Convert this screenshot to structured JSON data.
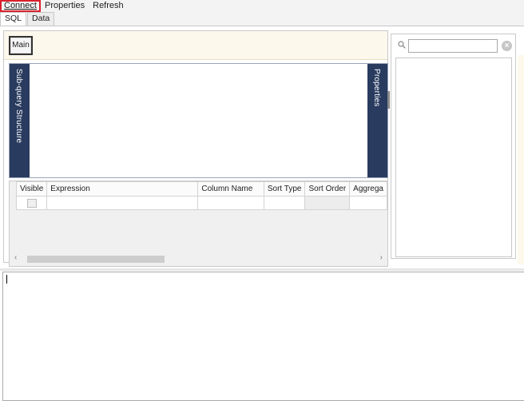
{
  "menu": {
    "items": [
      {
        "label": "Connect"
      },
      {
        "label": "Properties"
      },
      {
        "label": "Refresh"
      }
    ]
  },
  "tabs": [
    {
      "label": "SQL",
      "selected": true
    },
    {
      "label": "Data",
      "selected": false
    }
  ],
  "designer": {
    "query_tab_label": "Main",
    "left_side_label": "Sub-query Structure",
    "right_side_label": "Properties"
  },
  "grid": {
    "columns": [
      "Visible",
      "Expression",
      "Column Name",
      "Sort Type",
      "Sort Order",
      "Aggrega"
    ],
    "rows": [
      {
        "visible": false,
        "expression": "",
        "column_name": "",
        "sort_type": "",
        "sort_order": "",
        "aggregate": ""
      }
    ]
  },
  "search": {
    "placeholder": "",
    "value": ""
  },
  "sql_editor": {
    "text": ""
  },
  "colors": {
    "side_panel": "#293b5f",
    "query_tab_bg": "#fdf8ec",
    "highlight": "#d9202c"
  }
}
